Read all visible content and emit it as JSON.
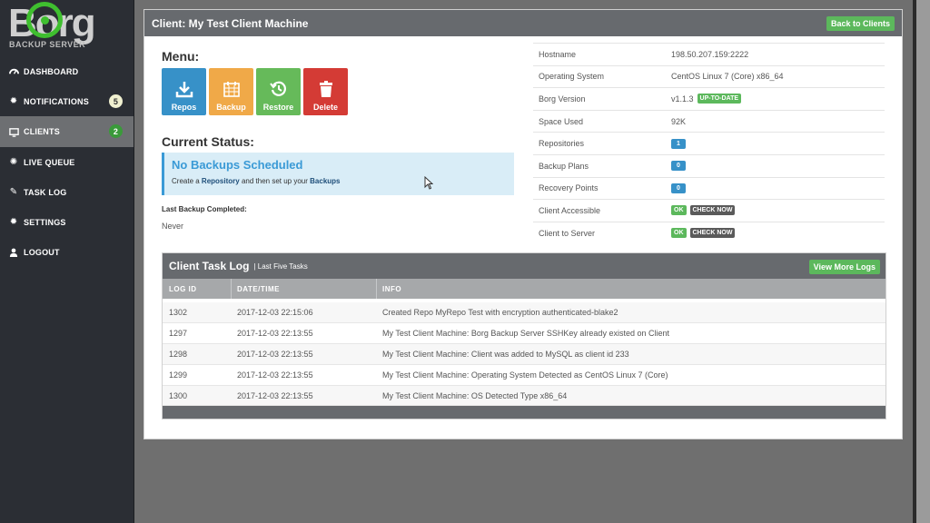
{
  "brand": {
    "wordmark": "Borg",
    "subtitle": "BACKUP SERVER"
  },
  "sidebar": {
    "items": [
      {
        "label": "DASHBOARD",
        "icon": "dashboard-icon"
      },
      {
        "label": "NOTIFICATIONS",
        "icon": "gear-icon",
        "badge": "5"
      },
      {
        "label": "CLIENTS",
        "icon": "monitor-icon",
        "badge": "2",
        "active": true
      },
      {
        "label": "LIVE QUEUE",
        "icon": "spinner-icon"
      },
      {
        "label": "TASK LOG",
        "icon": "pencil-icon"
      },
      {
        "label": "SETTINGS",
        "icon": "gear-icon"
      },
      {
        "label": "LOGOUT",
        "icon": "user-icon"
      }
    ]
  },
  "panel": {
    "title": "Client: My Test Client Machine",
    "back_button": "Back to Clients"
  },
  "menu": {
    "title": "Menu:",
    "tiles": [
      {
        "label": "Repos",
        "icon": "download-icon"
      },
      {
        "label": "Backup",
        "icon": "calendar-icon"
      },
      {
        "label": "Restore",
        "icon": "history-icon"
      },
      {
        "label": "Delete",
        "icon": "trash-icon"
      }
    ]
  },
  "status": {
    "title": "Current Status:",
    "alert_heading": "No Backups Scheduled",
    "alert_pre": "Create a",
    "alert_link1": "Repository",
    "alert_mid": "and then set up your",
    "alert_link2": "Backups",
    "last_label": "Last Backup Completed:",
    "last_value": "Never"
  },
  "info": {
    "hostname_label": "Hostname",
    "hostname": "198.50.207.159:2222",
    "os_label": "Operating System",
    "os": "CentOS Linux 7 (Core) x86_64",
    "borg_label": "Borg Version",
    "borg": "v1.1.3",
    "borg_badge": "UP-TO-DATE",
    "space_label": "Space Used",
    "space": "92K",
    "repos_label": "Repositories",
    "repos": "1",
    "plans_label": "Backup Plans",
    "plans": "0",
    "points_label": "Recovery Points",
    "points": "0",
    "access_label": "Client Accessible",
    "access_ok": "OK",
    "access_check": "CHECK NOW",
    "c2s_label": "Client to Server",
    "c2s_ok": "OK",
    "c2s_check": "CHECK NOW"
  },
  "log": {
    "title": "Client Task Log",
    "subtitle": "| Last Five Tasks",
    "more_button": "View More Logs",
    "columns": [
      "LOG ID",
      "DATE/TIME",
      "INFO"
    ],
    "rows": [
      {
        "id": "1302",
        "time": "2017-12-03 22:15:06",
        "info": "Created Repo MyRepo Test with encryption authenticated-blake2"
      },
      {
        "id": "1297",
        "time": "2017-12-03 22:13:55",
        "info": "My Test Client Machine: Borg Backup Server SSHKey already existed on Client"
      },
      {
        "id": "1298",
        "time": "2017-12-03 22:13:55",
        "info": "My Test Client Machine: Client was added to MySQL as client id 233"
      },
      {
        "id": "1299",
        "time": "2017-12-03 22:13:55",
        "info": "My Test Client Machine: Operating System Detected as CentOS Linux 7 (Core)"
      },
      {
        "id": "1300",
        "time": "2017-12-03 22:13:55",
        "info": "My Test Client Machine: OS Detected Type x86_64"
      }
    ]
  },
  "colors": {
    "accent_green": "#5cb85c",
    "accent_blue": "#3791c8",
    "header_gray": "#676a6e",
    "sidebar_bg": "#2b2e34"
  }
}
